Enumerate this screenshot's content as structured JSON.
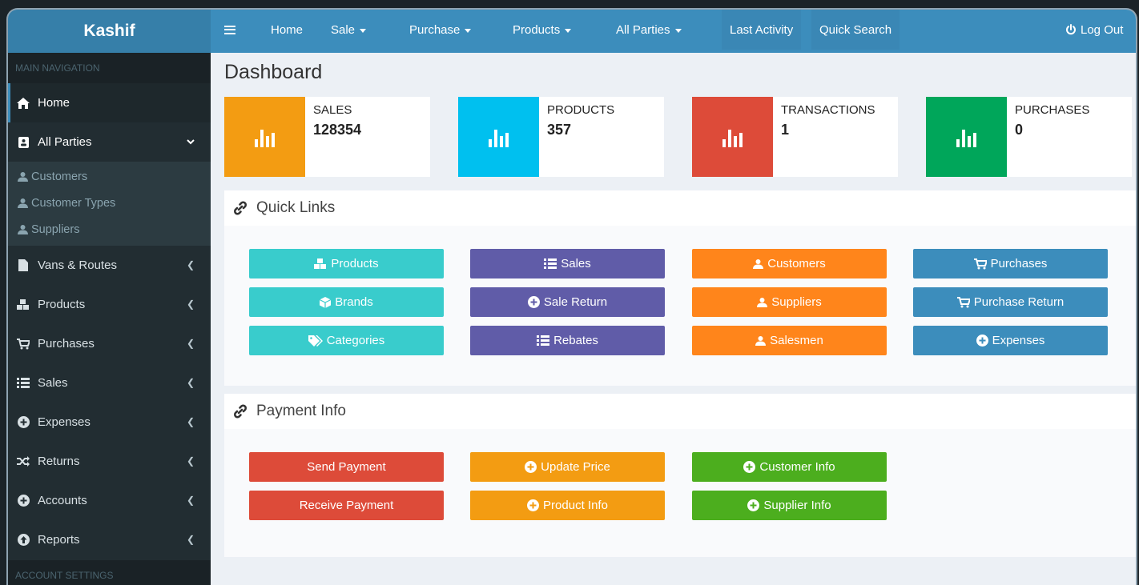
{
  "app": {
    "logo": "Kashif"
  },
  "topnav": {
    "home": "Home",
    "sale": "Sale",
    "purchase": "Purchase",
    "products": "Products",
    "all_parties": "All Parties",
    "last_activity": "Last Activity",
    "quick_search": "Quick Search",
    "logout": "Log Out"
  },
  "sidebar": {
    "header": "MAIN NAVIGATION",
    "footer": "ACCOUNT SETTINGS",
    "items": [
      {
        "label": "Home",
        "icon": "home-icon"
      },
      {
        "label": "All Parties",
        "icon": "address-book-icon"
      },
      {
        "label": "Vans & Routes",
        "icon": "file-icon"
      },
      {
        "label": "Products",
        "icon": "cubes-icon"
      },
      {
        "label": "Purchases",
        "icon": "cart-icon"
      },
      {
        "label": "Sales",
        "icon": "list-icon"
      },
      {
        "label": "Expenses",
        "icon": "plus-circle-icon"
      },
      {
        "label": "Returns",
        "icon": "random-icon"
      },
      {
        "label": "Accounts",
        "icon": "plus-circle-icon"
      },
      {
        "label": "Reports",
        "icon": "arrow-circle-icon"
      }
    ],
    "submenu": [
      {
        "label": "Customers"
      },
      {
        "label": "Customer Types"
      },
      {
        "label": "Suppliers"
      }
    ]
  },
  "page": {
    "title": "Dashboard"
  },
  "stats": [
    {
      "label": "SALES",
      "value": "128354",
      "color": "#f39c12"
    },
    {
      "label": "PRODUCTS",
      "value": "357",
      "color": "#00c0ef"
    },
    {
      "label": "TRANSACTIONS",
      "value": "1",
      "color": "#dd4b39"
    },
    {
      "label": "PURCHASES",
      "value": "0",
      "color": "#00a65a"
    }
  ],
  "quick_links": {
    "title": "Quick Links",
    "buttons": [
      {
        "label": "Products",
        "icon": "cubes-icon"
      },
      {
        "label": "Sales",
        "icon": "list-icon"
      },
      {
        "label": "Customers",
        "icon": "user-icon"
      },
      {
        "label": "Purchases",
        "icon": "cart-icon"
      },
      {
        "label": "Brands",
        "icon": "cube-icon"
      },
      {
        "label": "Sale Return",
        "icon": "plus-circle-icon"
      },
      {
        "label": "Suppliers",
        "icon": "user-icon"
      },
      {
        "label": "Purchase Return",
        "icon": "cart-icon"
      },
      {
        "label": "Categories",
        "icon": "tags-icon"
      },
      {
        "label": "Rebates",
        "icon": "list-icon"
      },
      {
        "label": "Salesmen",
        "icon": "user-icon"
      },
      {
        "label": "Expenses",
        "icon": "plus-circle-icon"
      }
    ]
  },
  "payment_info": {
    "title": "Payment Info",
    "buttons": [
      {
        "label": "Send Payment"
      },
      {
        "label": "Update Price",
        "icon": "plus-circle-icon"
      },
      {
        "label": "Customer Info",
        "icon": "plus-circle-icon"
      },
      {
        "label": "Receive Payment"
      },
      {
        "label": "Product Info",
        "icon": "plus-circle-icon"
      },
      {
        "label": "Supplier Info",
        "icon": "plus-circle-icon"
      }
    ]
  },
  "colors": {
    "topbar": "#3c8dbc",
    "sidebar": "#222d32",
    "teal": "#39cccc",
    "purple": "#605ca8",
    "orange": "#ff851b",
    "blue": "#3c8dbc",
    "red": "#dd4b39",
    "amber": "#f39c12",
    "green": "#4cae1e"
  }
}
